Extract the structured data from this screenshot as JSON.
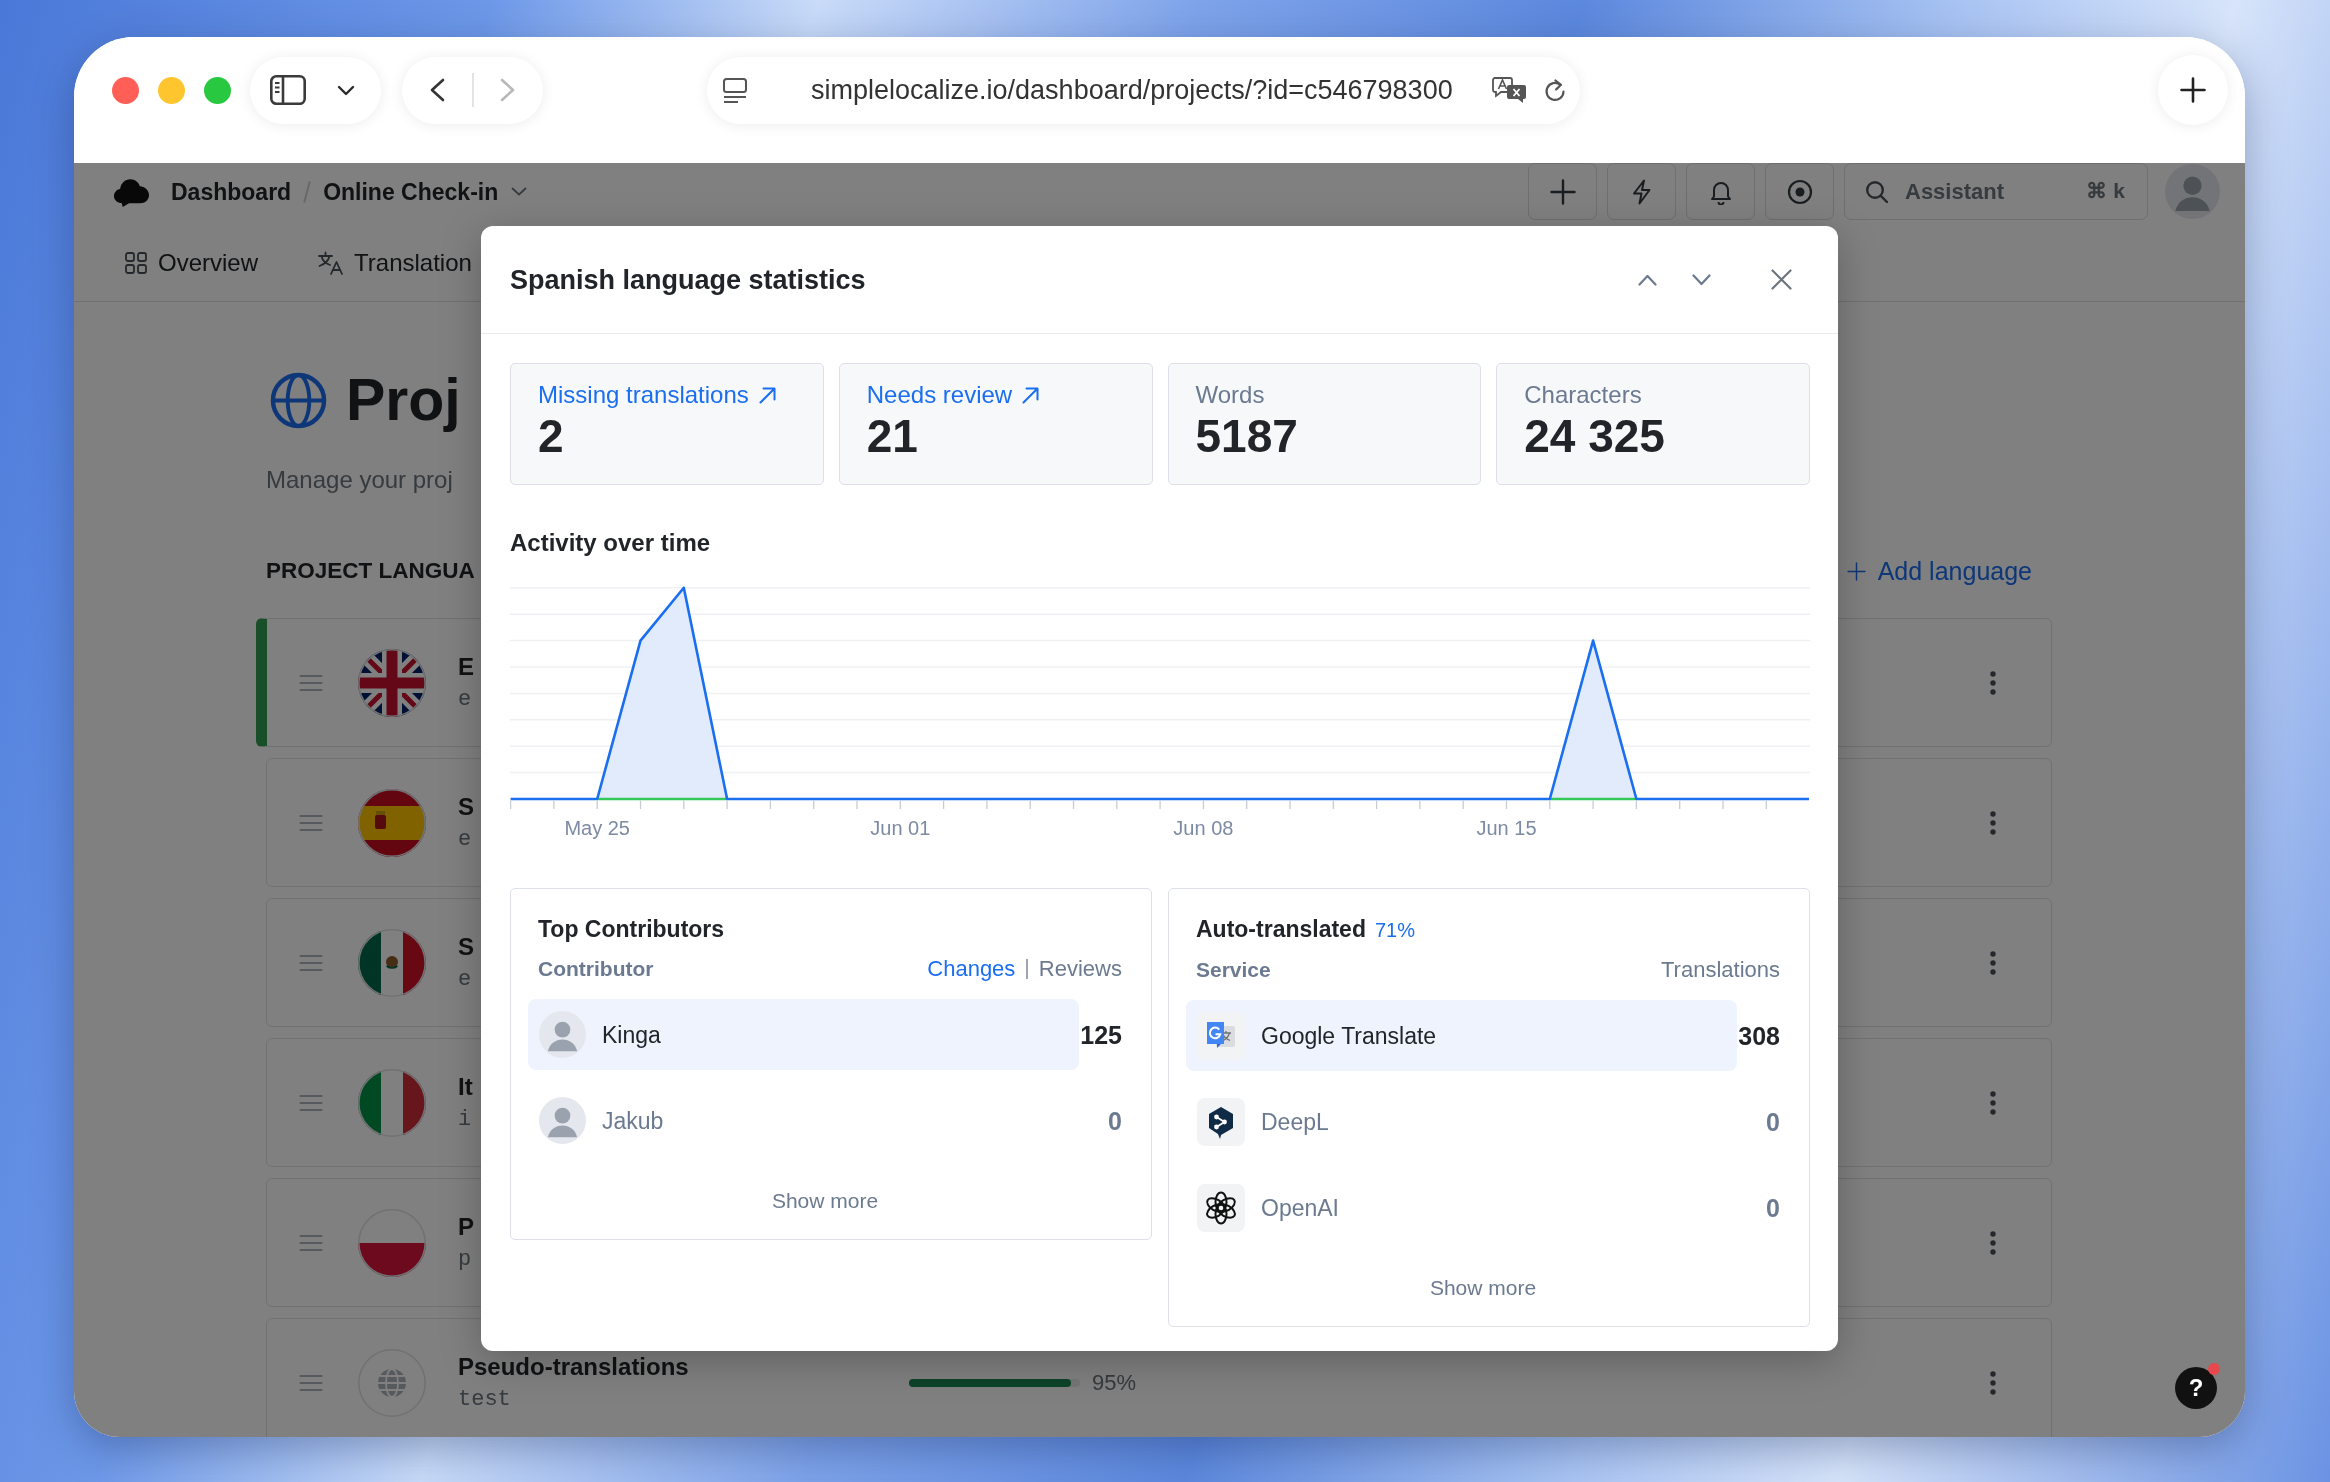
{
  "browser": {
    "url": "simplelocalize.io/dashboard/projects/?id=c546798300",
    "nav_buttons": [
      {
        "kind": "back",
        "disabled": false
      },
      {
        "kind": "forward",
        "disabled": true
      }
    ]
  },
  "header": {
    "breadcrumb": [
      {
        "label": "Dashboard"
      },
      {
        "label": "Online Check-in"
      }
    ],
    "search": {
      "placeholder": "Assistant",
      "shortcut": "⌘ k"
    }
  },
  "nav_tabs": [
    {
      "kind": "overview",
      "label": "Overview"
    },
    {
      "kind": "translations",
      "label": "Translation"
    }
  ],
  "page": {
    "title": "Proj",
    "subtitle": "Manage your proj",
    "section_title": "PROJECT LANGUA",
    "add_button": "Add language"
  },
  "languages": [
    {
      "kind": "gb",
      "name": "E",
      "code": "e",
      "selected": true
    },
    {
      "kind": "es",
      "name": "S",
      "code": "e",
      "selected": false
    },
    {
      "kind": "mx",
      "name": "S",
      "code": "e",
      "selected": false
    },
    {
      "kind": "it",
      "name": "It",
      "code": "i",
      "selected": false
    },
    {
      "kind": "pl",
      "name": "P",
      "code": "p",
      "selected": false
    },
    {
      "kind": "pseudo",
      "name": "Pseudo-translations",
      "code": "test",
      "selected": false,
      "progress": {
        "level": 0.95,
        "reading": "95%"
      }
    }
  ],
  "modal": {
    "title": "Spanish language statistics",
    "stats": [
      {
        "label": "Missing translations",
        "value": "2",
        "link": true
      },
      {
        "label": "Needs review",
        "value": "21",
        "link": true
      },
      {
        "label": "Words",
        "value": "5187",
        "link": false
      },
      {
        "label": "Characters",
        "value": "24 325",
        "link": false
      }
    ],
    "activity": {
      "title": "Activity over time",
      "x_labels": [
        "May 25",
        "Jun 01",
        "Jun 08",
        "Jun 15"
      ]
    },
    "contributors": {
      "title": "Top Contributors",
      "column": "Contributor",
      "tabs": [
        {
          "label": "Changes",
          "selected": true
        },
        {
          "label": "Reviews",
          "selected": false
        }
      ],
      "rows": [
        {
          "name": "Kinga",
          "value": "125",
          "highlighted": true
        },
        {
          "name": "Jakub",
          "value": "0",
          "highlighted": false
        }
      ],
      "more": "Show more"
    },
    "auto_translated": {
      "title": "Auto-translated",
      "share": "71%",
      "columns": [
        "Service",
        "Translations"
      ],
      "rows": [
        {
          "kind": "google",
          "name": "Google Translate",
          "value": "308",
          "highlighted": true
        },
        {
          "kind": "deepl",
          "name": "DeepL",
          "value": "0",
          "highlighted": false
        },
        {
          "kind": "openai",
          "name": "OpenAI",
          "value": "0",
          "highlighted": false
        }
      ],
      "more": "Show more"
    }
  },
  "help": {
    "label": "?",
    "notification": true
  }
}
